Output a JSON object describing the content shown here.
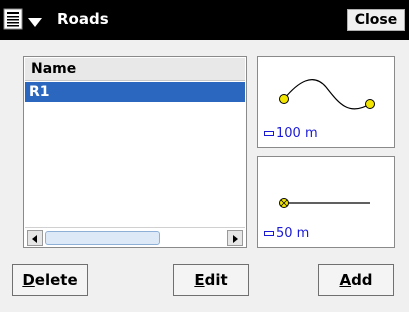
{
  "window": {
    "title": "Roads",
    "close_label": "Close"
  },
  "list": {
    "header": "Name",
    "rows": [
      "R1"
    ],
    "selected_index": 0
  },
  "previews": [
    {
      "scale_label": "100 m"
    },
    {
      "scale_label": "50 m"
    }
  ],
  "buttons": {
    "delete": {
      "mnemonic": "D",
      "rest": "elete"
    },
    "edit": {
      "mnemonic": "E",
      "rest": "dit"
    },
    "add": {
      "mnemonic": "A",
      "rest": "dd"
    }
  },
  "colors": {
    "title_bar": "#000000",
    "selection": "#2b67bf",
    "scale_text": "#1a1ad6",
    "road_point": "#f2e600"
  },
  "icons": [
    "start-menu-icon",
    "dropdown-arrow-icon",
    "scroll-left-icon",
    "scroll-right-icon"
  ]
}
